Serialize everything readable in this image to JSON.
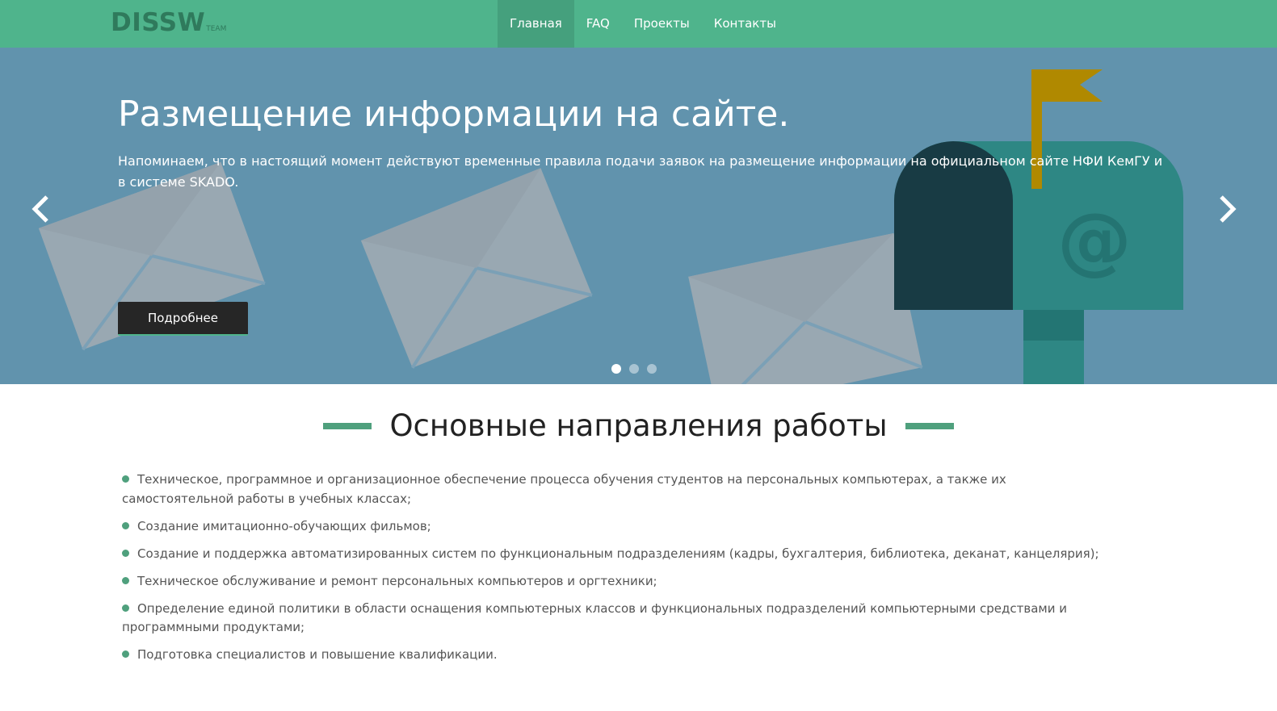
{
  "nav": {
    "brand": "DISSW",
    "brand_sub": "TEAM",
    "items": [
      {
        "label": "Главная"
      },
      {
        "label": "FAQ"
      },
      {
        "label": "Проекты"
      },
      {
        "label": "Контакты"
      }
    ]
  },
  "hero": {
    "title": "Размещение информации на сайте.",
    "text": "Напоминаем, что в настоящий момент действуют временные правила подачи заявок на размещение информации на официальном сайте НФИ КемГУ и в системе SKADO.",
    "button": "Подробнее",
    "slides_count": 3,
    "active_slide": 1
  },
  "section": {
    "title": "Основные направления работы",
    "items": [
      "Техническое, программное и организационное обеспечение процесса обучения студентов на персональных компьютерах, а также их самостоятельной работы в учебных классах;",
      "Создание имитационно-обучающих фильмов;",
      "Создание и поддержка автоматизированных систем по функциональным подразделениям (кадры, бухгалтерия, библиотека, деканат, канцелярия);",
      "Техническое обслуживание и ремонт персональных компьютеров и оргтехники;",
      "Определение единой политики в области оснащения компьютерных классов и функциональных подразделений компьютерными средствами и программными продуктами;",
      "Подготовка специалистов и повышение квалификации."
    ]
  },
  "colors": {
    "nav_bg": "#4fb48c",
    "hero_bg": "#6193ad",
    "accent": "#4fa07d",
    "button_bg": "#262626"
  },
  "icons": [
    "chevron-left-icon",
    "chevron-right-icon",
    "envelope-icon",
    "mailbox-icon",
    "flag-icon",
    "at-sign-icon"
  ]
}
